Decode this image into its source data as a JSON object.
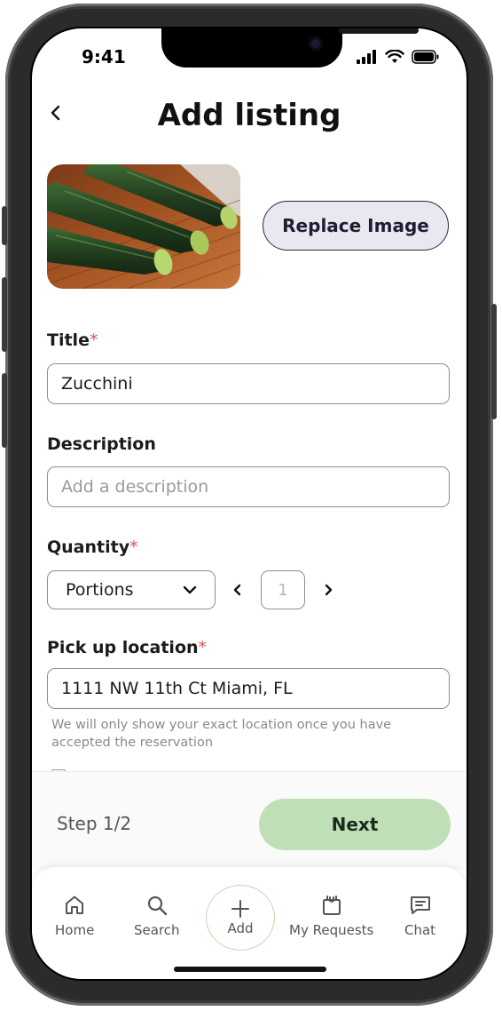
{
  "status_bar": {
    "time": "9:41"
  },
  "header": {
    "title": "Add listing"
  },
  "image_section": {
    "replace_label": "Replace Image"
  },
  "form": {
    "title_label": "Title",
    "title_value": "Zucchini",
    "description_label": "Description",
    "description_placeholder": "Add a description",
    "quantity_label": "Quantity",
    "quantity_unit": "Portions",
    "quantity_value": "1",
    "location_label": "Pick up location",
    "location_value": "1111 NW 11th Ct Miami, FL",
    "location_helper": "We will only show your exact location once you have accepted the reservation",
    "required_marker": "*"
  },
  "footer": {
    "step": "Step 1/2",
    "next_label": "Next"
  },
  "tabbar": {
    "items": [
      {
        "label": "Home",
        "icon": "home-icon"
      },
      {
        "label": "Search",
        "icon": "search-icon"
      },
      {
        "label": "Add",
        "icon": "plus-icon"
      },
      {
        "label": "My Requests",
        "icon": "bag-icon"
      },
      {
        "label": "Chat",
        "icon": "chat-icon"
      }
    ]
  },
  "colors": {
    "accent": "#bfe0b7",
    "required": "#e0525a",
    "button_bg": "#e9e8f0"
  }
}
